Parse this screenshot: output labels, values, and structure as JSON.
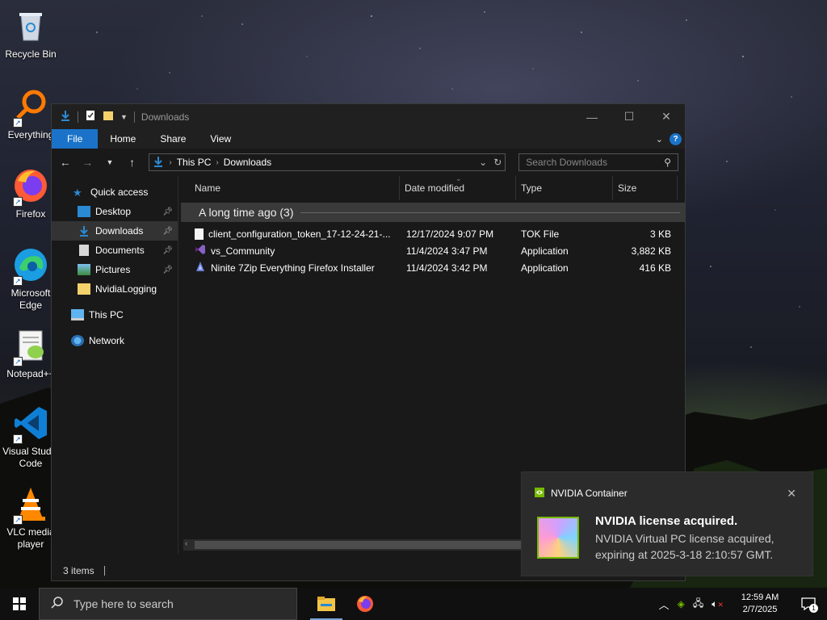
{
  "desktop": {
    "icons": [
      {
        "label": "Recycle Bin",
        "icon": "recycle-bin-icon"
      },
      {
        "label": "Everything",
        "icon": "everything-search-icon"
      },
      {
        "label": "Firefox",
        "icon": "firefox-icon"
      },
      {
        "label": "Microsoft Edge",
        "icon": "edge-icon"
      },
      {
        "label": "Notepad++",
        "icon": "notepad-plus-plus-icon"
      },
      {
        "label": "Visual Studio Code",
        "icon": "vscode-icon"
      },
      {
        "label": "VLC media player",
        "icon": "vlc-icon"
      }
    ]
  },
  "explorer": {
    "title": "Downloads",
    "ribbon": {
      "file": "File",
      "home": "Home",
      "share": "Share",
      "view": "View",
      "help": "?"
    },
    "address": {
      "root": "This PC",
      "current": "Downloads"
    },
    "search_placeholder": "Search Downloads",
    "sidebar": {
      "quick_access": "Quick access",
      "items": [
        "Desktop",
        "Downloads",
        "Documents",
        "Pictures",
        "NvidiaLogging"
      ],
      "this_pc": "This PC",
      "network": "Network"
    },
    "columns": {
      "name": "Name",
      "date": "Date modified",
      "type": "Type",
      "size": "Size"
    },
    "group_label": "A long time ago (3)",
    "files": [
      {
        "name": "client_configuration_token_17-12-24-21-...",
        "date": "12/17/2024 9:07 PM",
        "type": "TOK File",
        "size": "3 KB"
      },
      {
        "name": "vs_Community",
        "date": "11/4/2024 3:47 PM",
        "type": "Application",
        "size": "3,882 KB"
      },
      {
        "name": "Ninite 7Zip Everything Firefox Installer",
        "date": "11/4/2024 3:42 PM",
        "type": "Application",
        "size": "416 KB"
      }
    ],
    "status": "3 items"
  },
  "toast": {
    "app": "NVIDIA Container",
    "title": "NVIDIA license acquired.",
    "message": "NVIDIA Virtual PC license acquired, expiring at 2025-3-18 2:10:57 GMT."
  },
  "taskbar": {
    "search_placeholder": "Type here to search",
    "time": "12:59 AM",
    "date": "2/7/2025",
    "notification_count": "1"
  },
  "colors": {
    "accent": "#1a73c9",
    "nvidia": "#76b900"
  }
}
